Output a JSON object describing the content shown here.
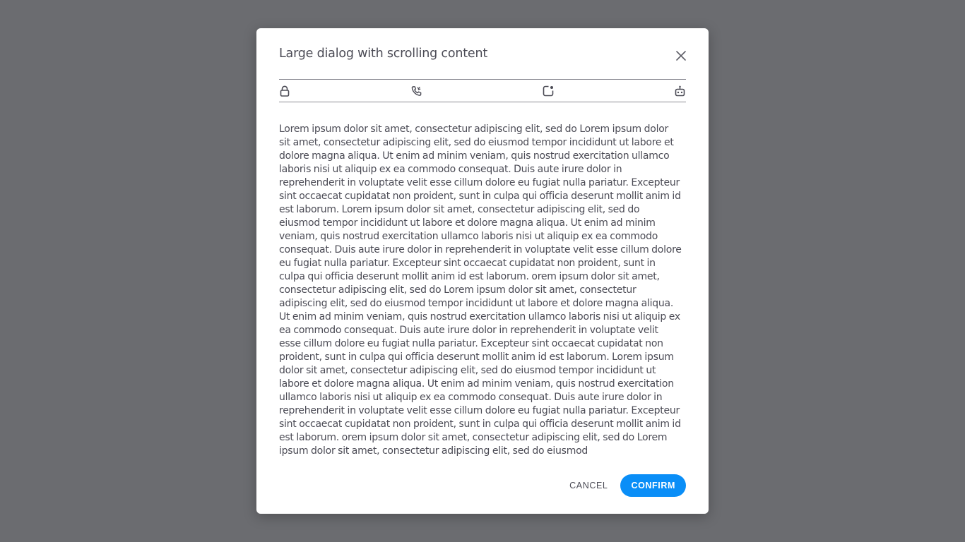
{
  "dialog": {
    "title": "Large dialog with scrolling content",
    "close_icon": "close-icon",
    "toolbar": {
      "icons": [
        "lock-icon",
        "phone-call-icon",
        "notification-square-icon",
        "robot-icon"
      ]
    },
    "content": "Lorem ipsum dolor sit amet, consectetur adipiscing elit, sed do Lorem ipsum dolor sit amet, consectetur adipiscing elit, sed do eiusmod tempor incididunt ut labore et dolore magna aliqua. Ut enim ad minim veniam, quis nostrud exercitation ullamco laboris nisi ut aliquip ex ea commodo consequat. Duis aute irure dolor in reprehenderit in voluptate velit esse cillum dolore eu fugiat nulla pariatur. Excepteur sint occaecat cupidatat non proident, sunt in culpa qui officia deserunt mollit anim id est laborum. Lorem ipsum dolor sit amet, consectetur adipiscing elit, sed do eiusmod tempor incididunt ut labore et dolore magna aliqua. Ut enim ad minim veniam, quis nostrud exercitation ullamco laboris nisi ut aliquip ex ea commodo consequat. Duis aute irure dolor in reprehenderit in voluptate velit esse cillum dolore eu fugiat nulla pariatur. Excepteur sint occaecat cupidatat non proident, sunt in culpa qui officia deserunt mollit anim id est laborum. orem ipsum dolor sit amet, consectetur adipiscing elit, sed do Lorem ipsum dolor sit amet, consectetur adipiscing elit, sed do eiusmod tempor incididunt ut labore et dolore magna aliqua. Ut enim ad minim veniam, quis nostrud exercitation ullamco laboris nisi ut aliquip ex ea commodo consequat. Duis aute irure dolor in reprehenderit in voluptate velit esse cillum dolore eu fugiat nulla pariatur. Excepteur sint occaecat cupidatat non proident, sunt in culpa qui officia deserunt mollit anim id est laborum. Lorem ipsum dolor sit amet, consectetur adipiscing elit, sed do eiusmod tempor incididunt ut labore et dolore magna aliqua. Ut enim ad minim veniam, quis nostrud exercitation ullamco laboris nisi ut aliquip ex ea commodo consequat. Duis aute irure dolor in reprehenderit in voluptate velit esse cillum dolore eu fugiat nulla pariatur. Excepteur sint occaecat cupidatat non proident, sunt in culpa qui officia deserunt mollit anim id est laborum. orem ipsum dolor sit amet, consectetur adipiscing elit, sed do Lorem ipsum dolor sit amet, consectetur adipiscing elit, sed do eiusmod",
    "buttons": {
      "cancel_label": "CANCEL",
      "confirm_label": "CONFIRM"
    }
  },
  "colors": {
    "backdrop": "#6b6c70",
    "text": "#4b4b55",
    "primary": "#0a8ef7"
  }
}
